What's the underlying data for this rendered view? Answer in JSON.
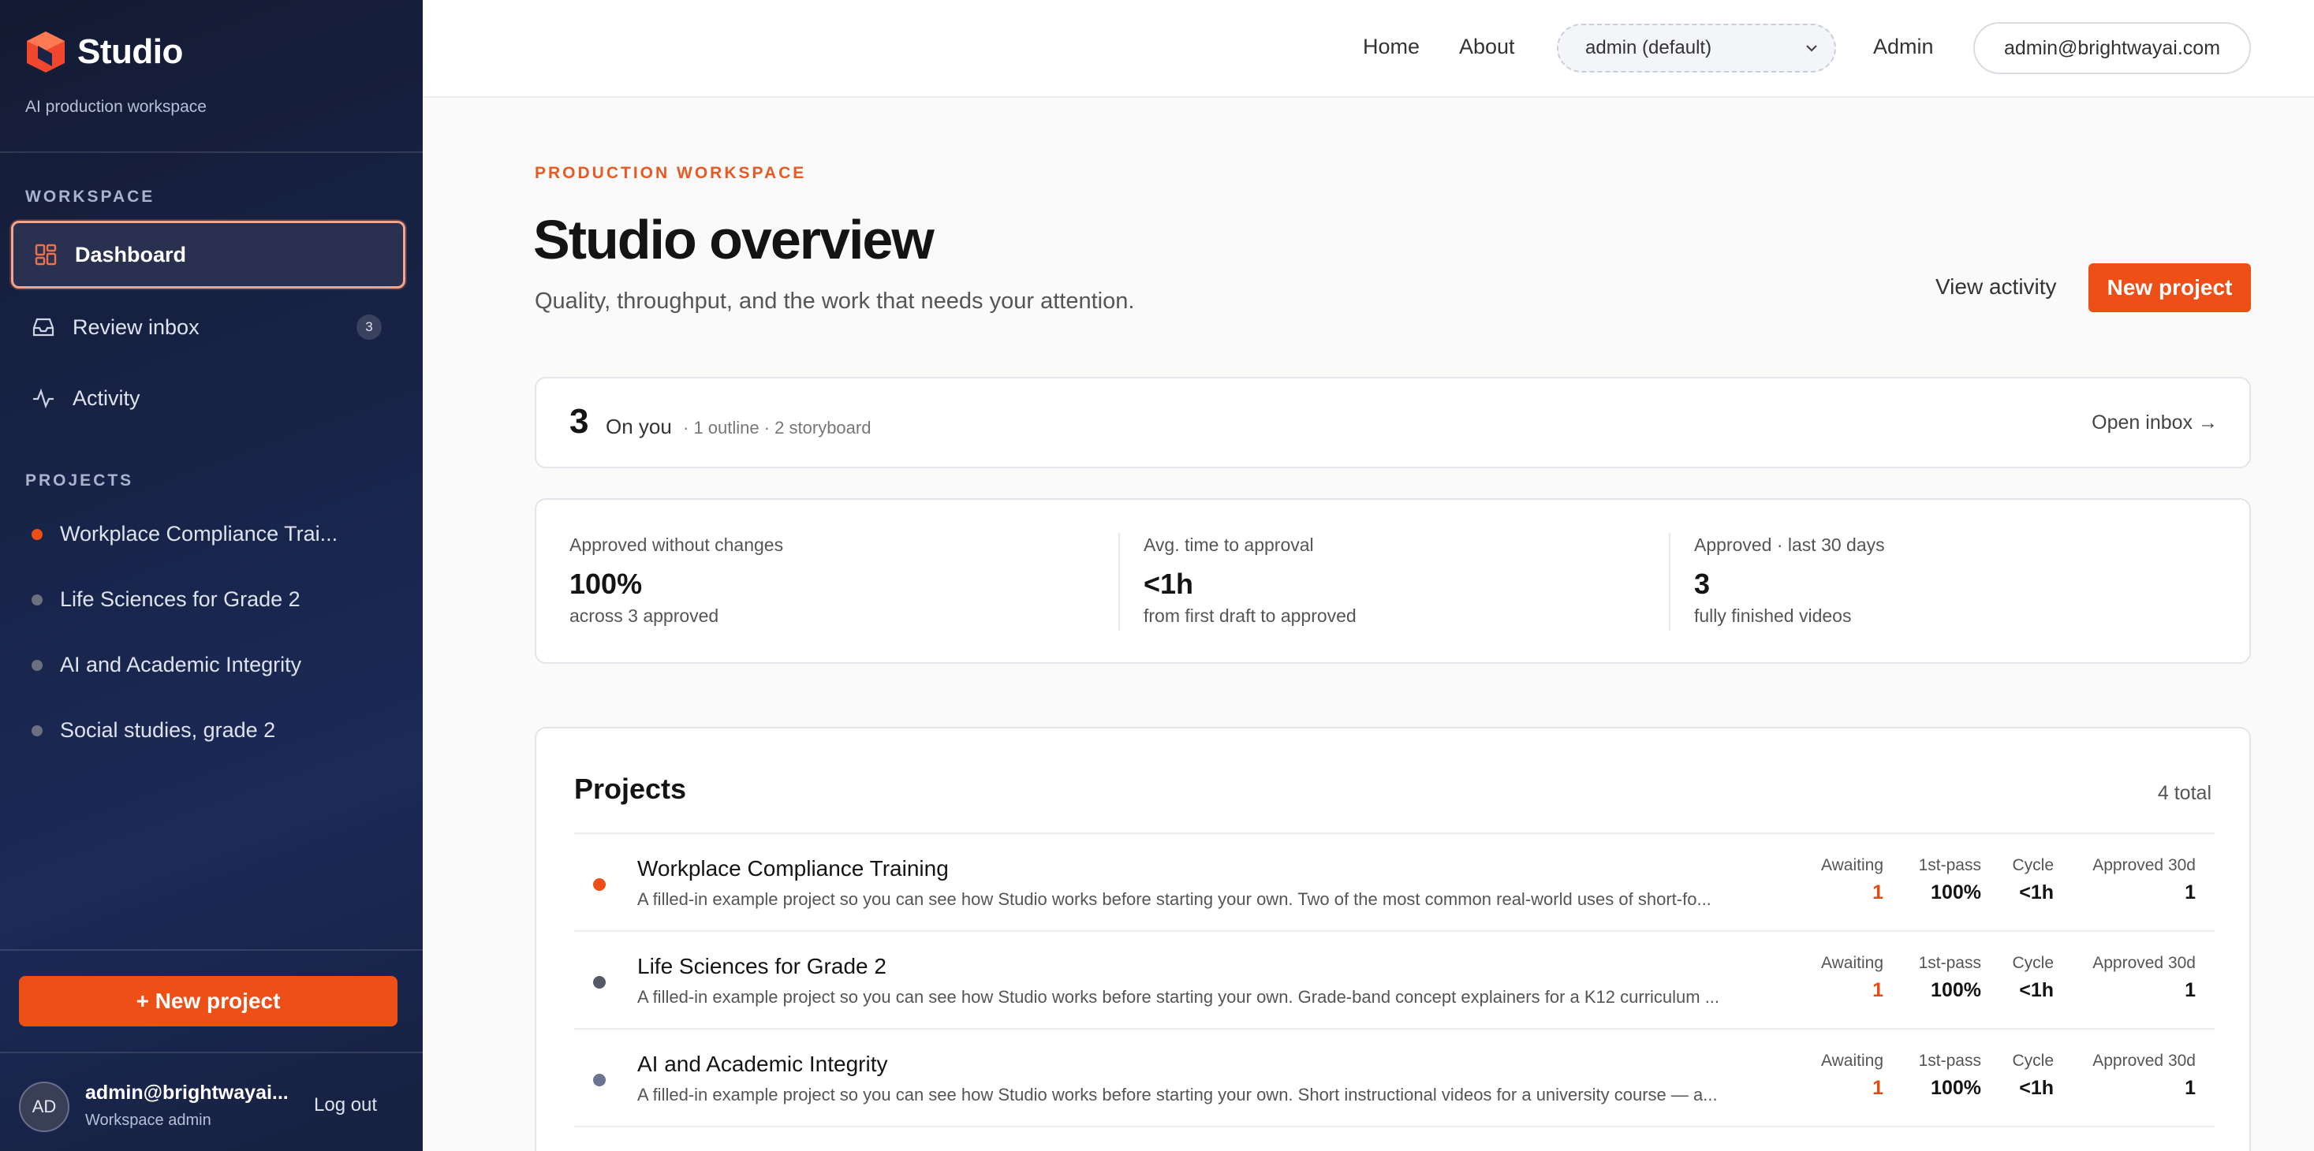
{
  "brand": {
    "name": "Studio",
    "subtitle": "AI production workspace"
  },
  "sidebar": {
    "workspace_heading": "WORKSPACE",
    "nav": [
      {
        "label": "Dashboard",
        "icon": "grid-icon",
        "active": true
      },
      {
        "label": "Review inbox",
        "icon": "inbox-icon",
        "badge": "3"
      },
      {
        "label": "Activity",
        "icon": "activity-icon"
      }
    ],
    "projects_heading": "PROJECTS",
    "projects": [
      {
        "label": "Workplace Compliance Trai...",
        "color": "#ee4f16"
      },
      {
        "label": "Life Sciences for Grade 2",
        "color": "#6b6f7e"
      },
      {
        "label": "AI and Academic Integrity",
        "color": "#6b6f7e"
      },
      {
        "label": "Social studies, grade 2",
        "color": "#6b6f7e"
      }
    ],
    "new_project_label": "+ New project",
    "user": {
      "initials": "AD",
      "email": "admin@brightwayai...",
      "role": "Workspace admin",
      "logout_label": "Log out"
    }
  },
  "topbar": {
    "links": [
      "Home",
      "About"
    ],
    "tenant_select": "admin (default)",
    "admin_link": "Admin",
    "email": "admin@brightwayai.com"
  },
  "header": {
    "eyebrow": "PRODUCTION WORKSPACE",
    "title": "Studio overview",
    "subtitle": "Quality, throughput, and the work that needs your attention.",
    "view_activity": "View activity",
    "new_project": "New project"
  },
  "on_you": {
    "count": "3",
    "label": "On you",
    "detail": "· 1 outline · 2 storyboard",
    "link": "Open inbox →"
  },
  "stats": [
    {
      "label": "Approved without changes",
      "value": "100%",
      "foot": "across 3 approved"
    },
    {
      "label": "Avg. time to approval",
      "value": "<1h",
      "foot": "from first draft to approved"
    },
    {
      "label": "Approved · last 30 days",
      "value": "3",
      "foot": "fully finished videos"
    }
  ],
  "projects": {
    "title": "Projects",
    "total": "4 total",
    "metric_labels": {
      "awaiting": "Awaiting",
      "first_pass": "1st-pass",
      "cycle": "Cycle",
      "approved": "Approved 30d"
    },
    "rows": [
      {
        "title": "Workplace Compliance Training",
        "desc": "A filled-in example project so you can see how Studio works before starting your own. Two of the most common real-world uses of short-fo...",
        "dot": "#ee4f16",
        "awaiting": "1",
        "first_pass": "100%",
        "cycle": "<1h",
        "approved": "1"
      },
      {
        "title": "Life Sciences for Grade 2",
        "desc": "A filled-in example project so you can see how Studio works before starting your own. Grade-band concept explainers for a K12 curriculum ...",
        "dot": "#555a66",
        "awaiting": "1",
        "first_pass": "100%",
        "cycle": "<1h",
        "approved": "1"
      },
      {
        "title": "AI and Academic Integrity",
        "desc": "A filled-in example project so you can see how Studio works before starting your own. Short instructional videos for a university course — a...",
        "dot": "#6b7592",
        "awaiting": "1",
        "first_pass": "100%",
        "cycle": "<1h",
        "approved": "1"
      }
    ]
  }
}
